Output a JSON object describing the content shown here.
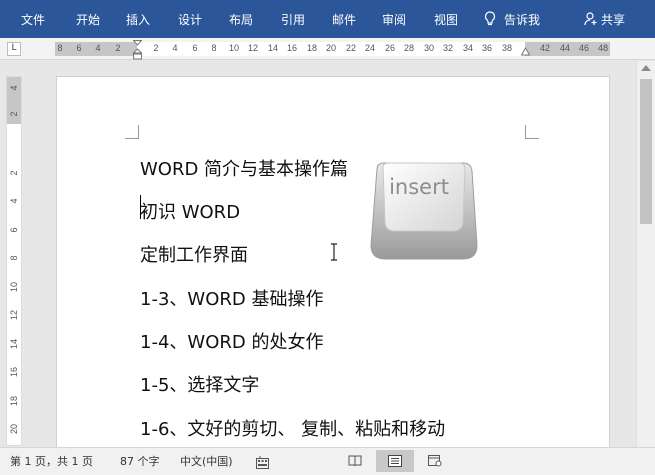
{
  "ribbon": {
    "tabs": [
      "文件",
      "开始",
      "插入",
      "设计",
      "布局",
      "引用",
      "邮件",
      "审阅",
      "视图"
    ],
    "tell_me": "告诉我",
    "share": "共享",
    "color": "#2b579a"
  },
  "ruler": {
    "tab_selector": "L",
    "left_numbers": [
      "8",
      "6",
      "4",
      "2"
    ],
    "right_numbers": [
      "2",
      "4",
      "6",
      "8",
      "10",
      "12",
      "14",
      "16",
      "18",
      "20",
      "22",
      "24",
      "26",
      "28",
      "30",
      "32",
      "34",
      "36",
      "38",
      "42",
      "44",
      "46",
      "48"
    ],
    "vertical_numbers": [
      "4",
      "2",
      "2",
      "4",
      "6",
      "8",
      "10",
      "12",
      "14",
      "16",
      "18",
      "20"
    ]
  },
  "document": {
    "lines": [
      "WORD 简介与基本操作篇",
      "初识 WORD",
      "定制工作界面",
      "1-3、WORD 基础操作",
      "1-4、WORD 的处女作",
      "1-5、选择文字",
      "1-6、文好的剪切、 复制、粘贴和移动"
    ],
    "key_label": "insert"
  },
  "status": {
    "page": "第 1 页，共 1 页",
    "words": "87 个字",
    "language": "中文(中国)"
  }
}
